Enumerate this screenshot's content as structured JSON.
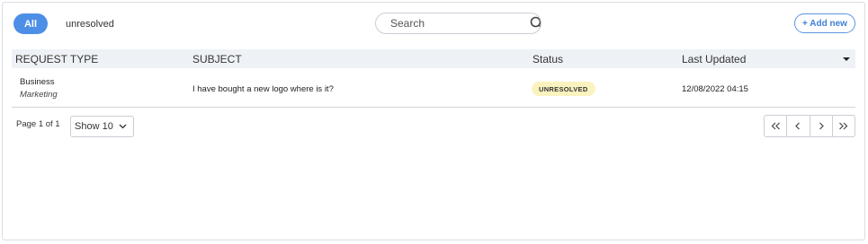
{
  "filters": {
    "all_label": "All",
    "unresolved_label": "unresolved"
  },
  "search": {
    "placeholder": "Search"
  },
  "toolbar": {
    "add_new_label": "+ Add new"
  },
  "table": {
    "columns": [
      "REQUEST TYPE",
      "SUBJECT",
      "Status",
      "Last Updated"
    ],
    "rows": [
      {
        "type": "Business",
        "subtype": "Marketing",
        "subject": "I have bought a new logo where is it?",
        "status": "UNRESOLVED",
        "updated": "12/08/2022 04:15"
      }
    ]
  },
  "pagination": {
    "page_info": "Page 1 of 1",
    "show_label": "Show 10"
  },
  "colors": {
    "accent": "#4d8fe6",
    "status_unresolved_bg": "#fbf3bf",
    "header_bg": "#eef2f7"
  }
}
